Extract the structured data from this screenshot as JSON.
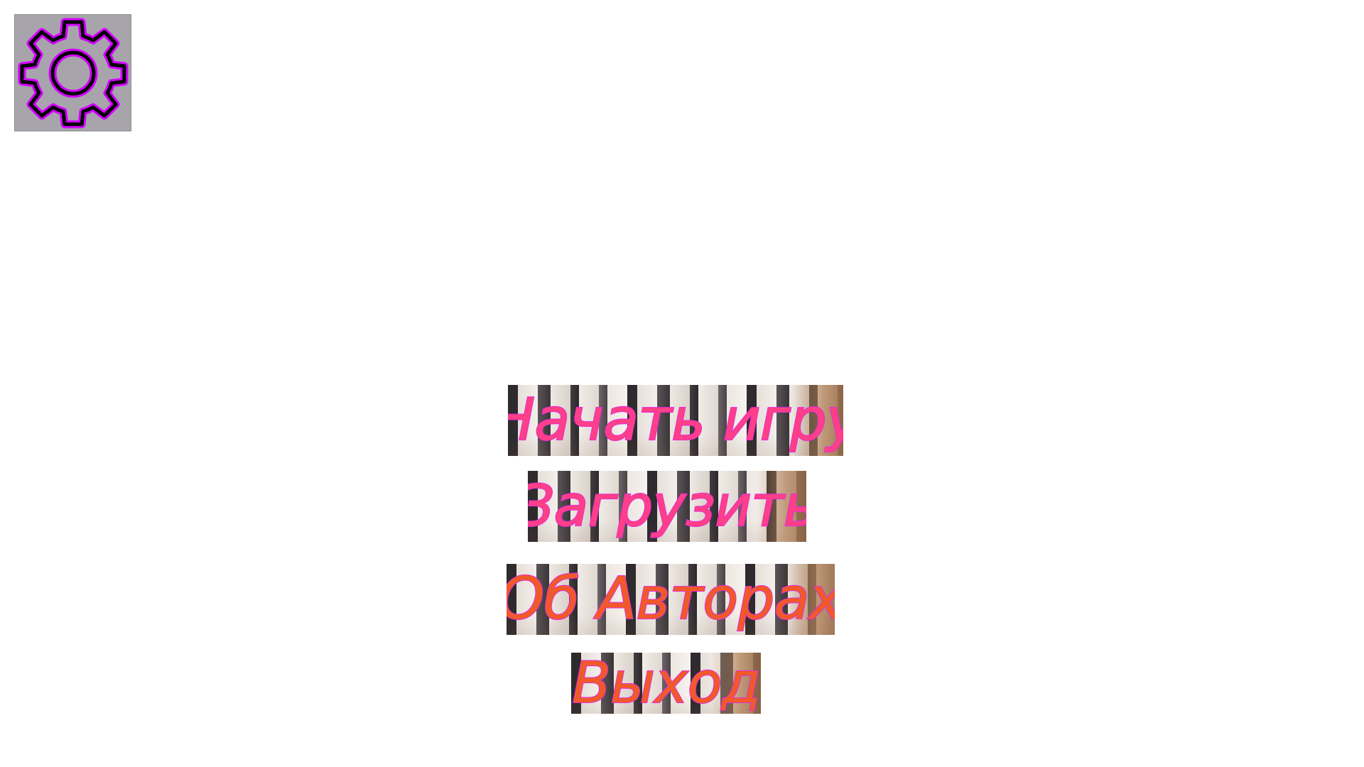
{
  "settings": {
    "icon": "gear-icon"
  },
  "menu": {
    "items": [
      {
        "label": "Начать игру"
      },
      {
        "label": "Загрузить"
      },
      {
        "label": "Об Авторах"
      },
      {
        "label": "Выход"
      }
    ]
  },
  "colors": {
    "background": "#ffffff",
    "settings_bg": "#a7a5ab",
    "gear_stroke": "#000000",
    "gear_glow": "#d400ff",
    "label_fill": "#f05a28",
    "label_fill_alt": "#ff3f86",
    "label_outline": "#e62bd8"
  }
}
